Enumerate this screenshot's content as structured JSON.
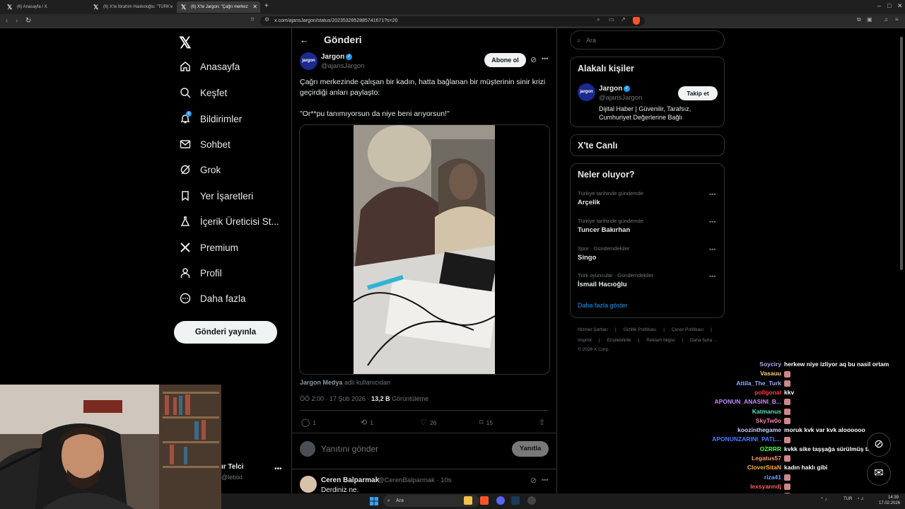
{
  "browser": {
    "tabs": [
      {
        "label": "(6) Anasayfa / X"
      },
      {
        "label": "(6) X'te İbrahim Haskoloğlu: \"TÜRK'e"
      },
      {
        "label": "(6) X'te Jargon: \"Çağrı merkez"
      }
    ],
    "url": "x.com/ajansJargon/status/2023532852885741671?s=20"
  },
  "sidebar": {
    "items": [
      {
        "label": "Anasayfa"
      },
      {
        "label": "Keşfet"
      },
      {
        "label": "Bildirimler"
      },
      {
        "label": "Sohbet"
      },
      {
        "label": "Grok"
      },
      {
        "label": "Yer İşaretleri"
      },
      {
        "label": "İçerik Üreticisi St..."
      },
      {
        "label": "Premium"
      },
      {
        "label": "Profil"
      },
      {
        "label": "Daha fazla"
      }
    ],
    "notif_count": "6",
    "post_button": "Gönderi yayınla",
    "account_name": "ır Telci",
    "account_handle": "@lebixi"
  },
  "post": {
    "header": "Gönderi",
    "author": "Jargon",
    "handle": "@ajansJargon",
    "subscribe": "Abone ol",
    "text_line1": "Çağrı merkezinde çalışan bir kadın, hatta bağlanan bir müşterinin sinir krizi geçirdiği anları paylaşto:",
    "text_line2": "\"Or**pu tanımıyorsun da niye beni arıyorsun!\"",
    "source_name": "Jargon Medya",
    "source_suffix": "adlı kullanıcıdan",
    "time": "ÖÖ 2:00 · 17 Şub 2026 ·",
    "views": "13,2 B",
    "views_label": "Görüntüleme",
    "replies": "1",
    "reposts": "1",
    "likes": "26",
    "bookmarks": "15",
    "reply_placeholder": "Yanıtını gönder",
    "reply_button": "Yanıtla"
  },
  "reply": {
    "name": "Ceren Balparmak",
    "handle": "@CerenBalparmak · 10s",
    "text": "Derdiniz ne."
  },
  "right": {
    "search_placeholder": "Ara",
    "related_title": "Alakalı kişiler",
    "related_name": "Jargon",
    "related_handle": "@ajansJargon",
    "follow": "Takip et",
    "related_bio": "Dijital Haber | Güvenilir, Tarafsız, Cumhuriyet Değerlerine Bağlı",
    "live_title": "X'te Canlı",
    "trends_title": "Neler oluyor?",
    "trends": [
      {
        "meta": "Türkiye tarihinde gündemde",
        "name": "Arçelik"
      },
      {
        "meta": "Türkiye tarihinde gündemde",
        "name": "Tuncer Bakırhan"
      },
      {
        "meta": "Spor · Gündemdekiler",
        "name": "Singo"
      },
      {
        "meta": "Türk oyuncular · Gündemdekiler",
        "name": "İsmail Hacıoğlu"
      }
    ],
    "show_more": "Daha fazla göster",
    "footer1": [
      "Hizmet Şartları",
      "|",
      "Gizlilik Politikası",
      "|",
      "Çerez Politikası",
      "|"
    ],
    "footer2": [
      "Imprint",
      "|",
      "Erişilebilirlik",
      "|",
      "Reklam bilgisi",
      "|",
      "Daha fazla ..."
    ],
    "copyright": "© 2026 X Corp."
  },
  "chat": [
    {
      "user": "Soyciry",
      "color": "#b9a3ff",
      "msg": "herkew niye izliyor aq bu nasil ortam"
    },
    {
      "user": "Vasauu",
      "color": "#ffd27a",
      "msg": ""
    },
    {
      "user": "Attila_The_Turk",
      "color": "#8fb0ff",
      "msg": ""
    },
    {
      "user": "pollgonal",
      "color": "#ff4040",
      "msg": "kkv"
    },
    {
      "user": "APONUN_ANASINI_B...",
      "color": "#c58cff",
      "msg": ""
    },
    {
      "user": "Katmanus",
      "color": "#5fe0c0",
      "msg": ""
    },
    {
      "user": "SkyTw0o",
      "color": "#ff7ab0",
      "msg": ""
    },
    {
      "user": "koozinthegame",
      "color": "#d0d0ff",
      "msg": "moruk kvk var kvk aloooooo"
    },
    {
      "user": "APONUNZARINI_PATL...",
      "color": "#4d7cff",
      "msg": ""
    },
    {
      "user": "OZRRR",
      "color": "#4dff4d",
      "msg": "kvkk sike taşşağa sürülmüş tabi"
    },
    {
      "user": "Legatus57",
      "color": "#ff9f6b",
      "msg": ""
    },
    {
      "user": "CloverSitaN",
      "color": "#ffb040",
      "msg": "kadın haklı gibi"
    },
    {
      "user": "riza41",
      "color": "#6fa0ff",
      "msg": ""
    },
    {
      "user": "lexsyanndj",
      "color": "#ff6060",
      "msg": ""
    },
    {
      "user": "Rhyno_Kirai",
      "color": "#c9a0ff",
      "msg": ""
    }
  ],
  "taskbar": {
    "search": "Ara",
    "lang": "TUR",
    "time": "14:39",
    "date": "17.02.2026"
  }
}
